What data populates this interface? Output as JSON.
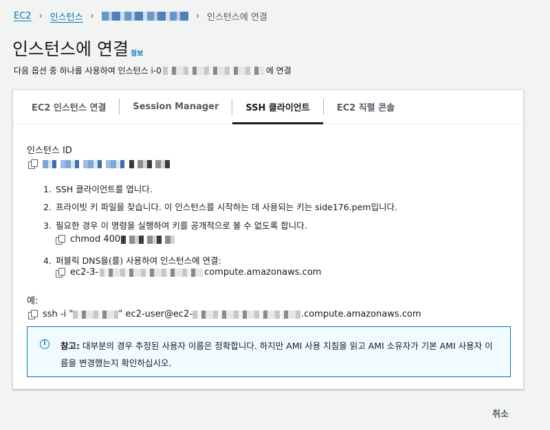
{
  "breadcrumb": {
    "ec2": "EC2",
    "instances": "인스턴스",
    "current": "인스턴스에 연결"
  },
  "header": {
    "title": "인스턴스에 연결",
    "info": "정보",
    "subtitle_prefix": "다음 옵션 중 하나를 사용하여 인스턴스 i-0",
    "subtitle_suffix": "에 연결"
  },
  "tabs": [
    {
      "label": "EC2 인스턴스 연결",
      "active": false
    },
    {
      "label": "Session Manager",
      "active": false
    },
    {
      "label": "SSH 클라이언트",
      "active": true
    },
    {
      "label": "EC2 직렬 콘솔",
      "active": false
    }
  ],
  "instance": {
    "id_label": "인스턴스 ID"
  },
  "steps": {
    "s1": "SSH 클라이언트를 엽니다.",
    "s2": "프라이빗 키 파일을 찾습니다. 이 인스턴스를 시작하는 데 사용되는 키는 side176.pem입니다.",
    "s3": "필요한 경우 이 명령을 실행하여 키를 공개적으로 볼 수 없도록 합니다.",
    "chmod": "chmod 400",
    "s4": "퍼블릭 DNS을(를) 사용하여 인스턴스에 연결:",
    "dns_prefix": "ec2-3-",
    "dns_suffix": "compute.amazonaws.com"
  },
  "example": {
    "label": "예:",
    "ssh_prefix": "ssh -i \"",
    "ssh_mid": "\" ec2-user@ec2-",
    "ssh_suffix": ".compute.amazonaws.com"
  },
  "note": {
    "bold": "참고:",
    "text": " 대부분의 경우 추정된 사용자 이름은 정확합니다. 하지만 AMI 사용 지침을 읽고 AMI 소유자가 기본 AMI 사용자 이름을 변경했는지 확인하십시오."
  },
  "actions": {
    "cancel": "취소"
  },
  "colors": {
    "link": "#0073bb",
    "info_bg": "#f1faff",
    "page_bg": "#f2f3f3"
  }
}
